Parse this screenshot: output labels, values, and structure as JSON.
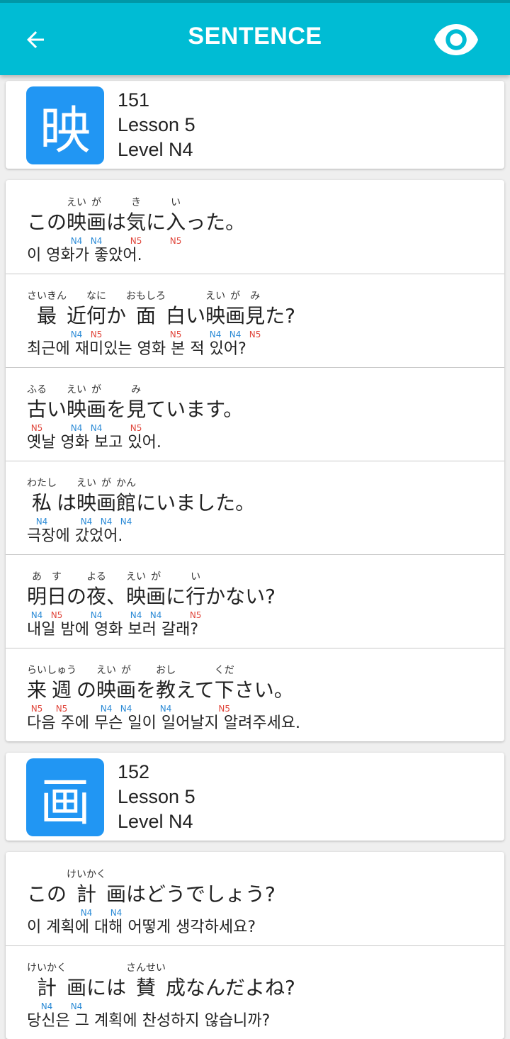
{
  "appbar": {
    "title": "SENTENCE",
    "back_icon": "arrow-left-icon",
    "eye_icon": "eye-icon",
    "bg_color": "#00bcd4"
  },
  "colors": {
    "kanji_box": "#2196f3",
    "n4": "#2a8ad6",
    "n5": "#e0453a"
  },
  "cards": [
    {
      "kanji": "映",
      "number": "151",
      "lesson": "Lesson 5",
      "level": "Level N4",
      "sentences": [
        {
          "tokens": [
            {
              "base": "この"
            },
            {
              "base": "映",
              "ruby": "えい",
              "level": "N4"
            },
            {
              "base": "画",
              "ruby": "が",
              "level": "N4"
            },
            {
              "base": "は"
            },
            {
              "base": "気",
              "ruby": "き",
              "level": "N5"
            },
            {
              "base": "に"
            },
            {
              "base": "入",
              "ruby": "い",
              "level": "N5"
            },
            {
              "base": "った。"
            }
          ],
          "korean": "이 영화가 좋았어."
        },
        {
          "tokens": [
            {
              "base": "最",
              "ruby": "さいきん"
            },
            {
              "base": "近",
              "level": "N4"
            },
            {
              "base": "何",
              "ruby": "なに",
              "level": "N5"
            },
            {
              "base": "か"
            },
            {
              "base": "面",
              "ruby": "おもしろ"
            },
            {
              "base": "白",
              "level": "N5"
            },
            {
              "base": "い"
            },
            {
              "base": "映",
              "ruby": "えい",
              "level": "N4"
            },
            {
              "base": "画",
              "ruby": "が",
              "level": "N4"
            },
            {
              "base": "見",
              "ruby": "み",
              "level": "N5"
            },
            {
              "base": "た?"
            }
          ],
          "korean": "최근에 재미있는 영화 본 적 있어?"
        },
        {
          "tokens": [
            {
              "base": "古",
              "ruby": "ふる",
              "level": "N5"
            },
            {
              "base": "い"
            },
            {
              "base": "映",
              "ruby": "えい",
              "level": "N4"
            },
            {
              "base": "画",
              "ruby": "が",
              "level": "N4"
            },
            {
              "base": "を"
            },
            {
              "base": "見",
              "ruby": "み",
              "level": "N5"
            },
            {
              "base": "ています。"
            }
          ],
          "korean": "옛날 영화 보고 있어."
        },
        {
          "tokens": [
            {
              "base": "私",
              "ruby": "わたし",
              "level": "N4"
            },
            {
              "base": "は"
            },
            {
              "base": "映",
              "ruby": "えい",
              "level": "N4"
            },
            {
              "base": "画",
              "ruby": "が",
              "level": "N4"
            },
            {
              "base": "館",
              "ruby": "かん",
              "level": "N4"
            },
            {
              "base": "にいました。"
            }
          ],
          "korean": "극장에 갔었어."
        },
        {
          "tokens": [
            {
              "base": "明",
              "ruby": "あ",
              "level": "N4"
            },
            {
              "base": "日",
              "ruby": "す",
              "level": "N5"
            },
            {
              "base": "の"
            },
            {
              "base": "夜",
              "ruby": "よる",
              "level": "N4"
            },
            {
              "base": "、"
            },
            {
              "base": "映",
              "ruby": "えい",
              "level": "N4"
            },
            {
              "base": "画",
              "ruby": "が",
              "level": "N4"
            },
            {
              "base": "に"
            },
            {
              "base": "行",
              "ruby": "い",
              "level": "N5"
            },
            {
              "base": "かない?"
            }
          ],
          "korean": "내일 밤에 영화 보러 갈래?"
        },
        {
          "tokens": [
            {
              "base": "来",
              "ruby": "らい",
              "level": "N5"
            },
            {
              "base": "週",
              "ruby": "しゅう",
              "level": "N5"
            },
            {
              "base": "の"
            },
            {
              "base": "映",
              "ruby": "えい",
              "level": "N4"
            },
            {
              "base": "画",
              "ruby": "が",
              "level": "N4"
            },
            {
              "base": "を"
            },
            {
              "base": "教",
              "ruby": "おし",
              "level": "N4"
            },
            {
              "base": "えて"
            },
            {
              "base": "下",
              "ruby": "くだ",
              "level": "N5"
            },
            {
              "base": "さい。"
            }
          ],
          "korean": "다음 주에 무슨 일이 일어날지 알려주세요."
        }
      ]
    },
    {
      "kanji": "画",
      "number": "152",
      "lesson": "Lesson 5",
      "level": "Level N4",
      "sentences": [
        {
          "tokens": [
            {
              "base": "この"
            },
            {
              "base": "計",
              "ruby": "けいかく",
              "level": "N4"
            },
            {
              "base": "画",
              "level": "N4"
            },
            {
              "base": "はどうでしょう?"
            }
          ],
          "korean": "이 계획에 대해 어떻게 생각하세요?"
        },
        {
          "tokens": [
            {
              "base": "計",
              "ruby": "けいかく",
              "level": "N4"
            },
            {
              "base": "画",
              "level": "N4"
            },
            {
              "base": "には"
            },
            {
              "base": "賛",
              "ruby": "さんせい"
            },
            {
              "base": "成"
            },
            {
              "base": "なんだよね?"
            }
          ],
          "korean": "당신은 그 계획에 찬성하지 않습니까?"
        }
      ]
    }
  ]
}
